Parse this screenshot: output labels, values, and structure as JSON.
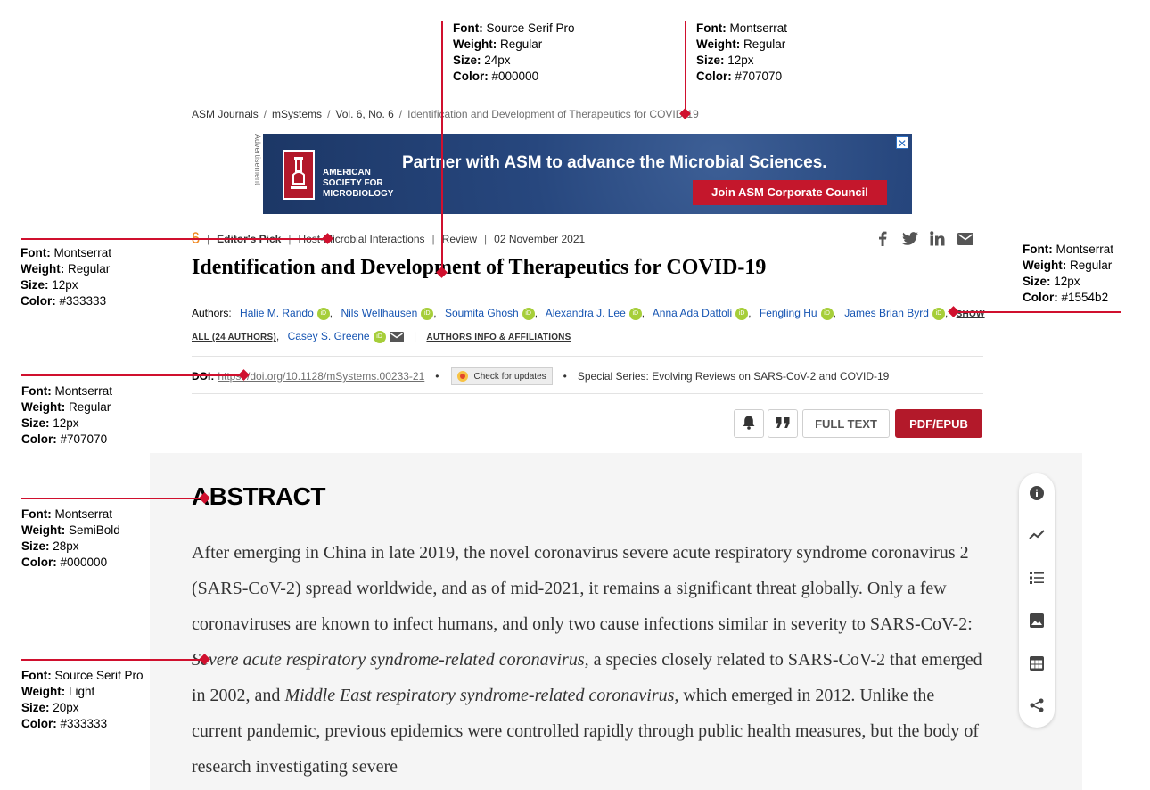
{
  "annotations": [
    {
      "id": "title-spec",
      "font": "Source Serif Pro",
      "weight": "Regular",
      "size": "24px",
      "color": "#000000"
    },
    {
      "id": "breadcrumb-spec",
      "font": "Montserrat",
      "weight": "Regular",
      "size": "12px",
      "color": "#707070"
    },
    {
      "id": "meta-spec",
      "font": "Montserrat",
      "weight": "Regular",
      "size": "12px",
      "color": "#333333"
    },
    {
      "id": "authors-spec",
      "font": "Montserrat",
      "weight": "Regular",
      "size": "12px",
      "color": "#1554b2"
    },
    {
      "id": "doi-spec",
      "font": "Montserrat",
      "weight": "Regular",
      "size": "12px",
      "color": "#707070"
    },
    {
      "id": "abstract-heading-spec",
      "font": "Montserrat",
      "weight": "SemiBold",
      "size": "28px",
      "color": "#000000"
    },
    {
      "id": "abstract-body-spec",
      "font": "Source Serif Pro",
      "weight": "Light",
      "size": "20px",
      "color": "#333333"
    }
  ],
  "spec_labels": {
    "font": "Font:",
    "weight": "Weight:",
    "size": "Size:",
    "color": "Color:"
  },
  "breadcrumb": {
    "items": [
      "ASM Journals",
      "mSystems",
      "Vol. 6, No. 6"
    ],
    "current": "Identification and Development of Therapeutics for COVID-19",
    "separator": "/"
  },
  "ad": {
    "label": "Advertisement",
    "org": "AMERICAN SOCIETY FOR MICROBIOLOGY",
    "headline": "Partner with ASM to advance the Microbial Sciences.",
    "cta": "Join ASM Corporate Council",
    "close": "✕"
  },
  "meta": {
    "open_access_icon": "open-access-icon",
    "editors_pick": "Editor's Pick",
    "section": "Host-Microbial Interactions",
    "type": "Review",
    "date": "02 November 2021"
  },
  "title": "Identification and Development of Therapeutics for COVID-19",
  "authors": {
    "label": "Authors",
    "list": [
      "Halie M. Rando",
      "Nils Wellhausen",
      "Soumita Ghosh",
      "Alexandra J. Lee",
      "Anna Ada Dattoli",
      "Fengling Hu",
      "James Brian Byrd"
    ],
    "show_all": "SHOW ALL (24 AUTHORS)",
    "corresponding": "Casey S. Greene",
    "info": "AUTHORS INFO & AFFILIATIONS",
    "orcid": "iD"
  },
  "doi": {
    "label": "DOI:",
    "url": "https://doi.org/10.1128/mSystems.00233-21",
    "check_updates": "Check for updates",
    "series": "Special Series: Evolving Reviews on SARS-CoV-2 and COVID-19"
  },
  "actions": {
    "alert_icon": "bell-icon",
    "cite_icon": "quote-icon",
    "full_text": "FULL TEXT",
    "pdf": "PDF/EPUB"
  },
  "abstract": {
    "heading": "ABSTRACT",
    "p1": "After emerging in China in late 2019, the novel coronavirus severe acute respiratory syndrome coronavirus 2 (SARS-CoV-2) spread worldwide, and as of mid-2021, it remains a significant threat globally. Only a few coronaviruses are known to infect humans, and only two cause infections similar in severity to SARS-CoV-2: ",
    "i1": "Severe acute respiratory syndrome-related coronavirus,",
    "p2": " a species closely related to SARS-CoV-2 that emerged in 2002, and ",
    "i2": "Middle East respiratory syndrome-related coronavirus,",
    "p3": " which emerged in 2012. Unlike the current pandemic, previous epidemics were controlled rapidly through public health measures, but the body of research investigating severe"
  },
  "side_tools": [
    "info-icon",
    "metrics-icon",
    "outline-icon",
    "figures-icon",
    "tables-icon",
    "share-icon"
  ],
  "colors": {
    "accent": "#b3192a",
    "link": "#1554b2",
    "annotation": "#d0102e"
  }
}
